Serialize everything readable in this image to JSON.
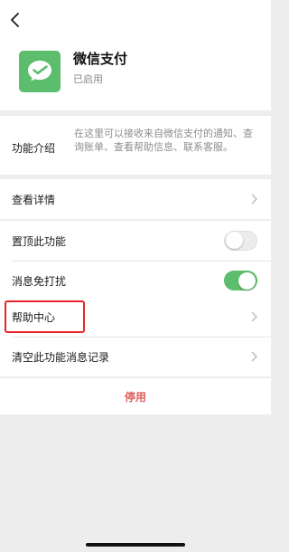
{
  "header": {
    "app_name": "微信支付",
    "status": "已启用"
  },
  "intro": {
    "label": "功能介绍",
    "description": "在这里可以接收来自微信支付的通知、查询账单、查看帮助信息、联系客服。"
  },
  "details": {
    "label": "查看详情"
  },
  "settings": {
    "pin_label": "置顶此功能",
    "pin_enabled": false,
    "mute_label": "消息免打扰",
    "mute_enabled": true
  },
  "help": {
    "help_center_label": "帮助中心",
    "clear_history_label": "清空此功能消息记录"
  },
  "actions": {
    "disable_label": "停用"
  },
  "colors": {
    "accent_green": "#5cbd6c",
    "danger_red": "#e05d55",
    "highlight_red": "#e8262a",
    "background": "#ededed"
  },
  "icons": [
    "back-arrow-icon",
    "wechat-pay-icon",
    "chevron-right-icon"
  ]
}
